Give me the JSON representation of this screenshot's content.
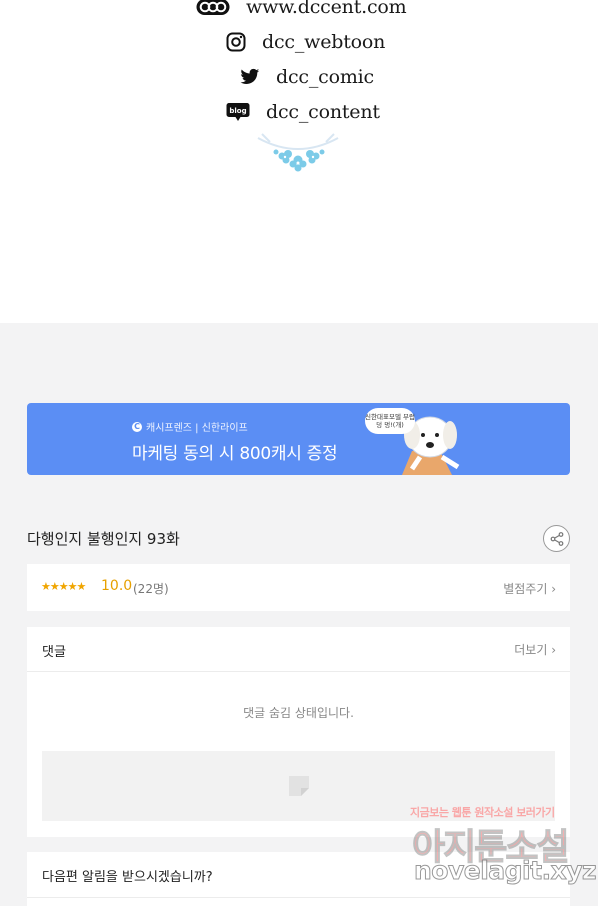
{
  "credits": {
    "items": [
      {
        "icon": "dcc-logo-icon",
        "text": "www.dccent.com"
      },
      {
        "icon": "instagram-icon",
        "text": "dcc_webtoon"
      },
      {
        "icon": "twitter-icon",
        "text": "dcc_comic"
      },
      {
        "icon": "blog-icon",
        "text": "dcc_content"
      }
    ],
    "blog_icon_text": "blog",
    "dcc_logo_text": "DCC"
  },
  "banner": {
    "brand": "캐시프렌즈 | 신한라이프",
    "promo": "마케팅 동의 시 800캐시 증정",
    "bubble": "신한대표모델 부럽덩 멍!(개)",
    "color": "#5b8ef4"
  },
  "episode": {
    "title": "다행인지 불행인지 93화"
  },
  "rating": {
    "stars": "★★★★★",
    "score": "10.0",
    "count": "(22명)",
    "rate_link": "별점주기 ›"
  },
  "comments": {
    "label": "댓글",
    "more_link": "더보기 ›",
    "hidden_message": "댓글 숨김 상태입니다."
  },
  "next_alert": {
    "label": "다음편 알림을 받으시겠습니까?"
  },
  "watermark": {
    "top": "지금보는 웹툰 원작소설 보러가기",
    "main": "아지툰소설",
    "url": "novelagit.xyz"
  }
}
